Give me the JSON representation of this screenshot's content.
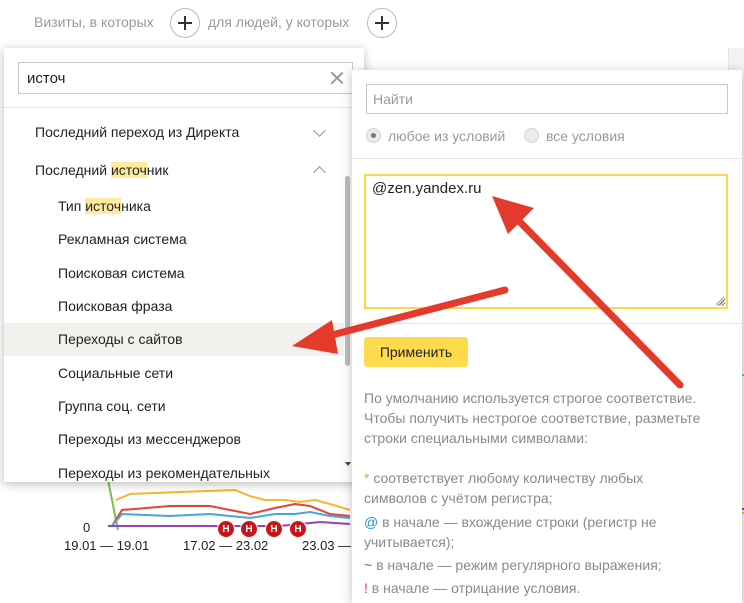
{
  "topbar": {
    "visits_label": "Визиты, в которых",
    "people_label": "для людей, у которых"
  },
  "dropdown": {
    "search_value": "источ",
    "items": [
      {
        "label": "Последний переход из Директа"
      },
      {
        "label_pre": "Последний ",
        "label_hl": "источ",
        "label_post": "ник"
      },
      {
        "label_pre": "Тип ",
        "label_hl": "источ",
        "label_post": "ника"
      },
      {
        "label": "Рекламная система"
      },
      {
        "label": "Поисковая система"
      },
      {
        "label": "Поисковая фраза"
      },
      {
        "label": "Переходы с сайтов"
      },
      {
        "label": "Социальные сети"
      },
      {
        "label": "Группа соц. сети"
      },
      {
        "label": "Переходы из мессенджеров"
      },
      {
        "label": "Переходы из рекомендательных"
      }
    ]
  },
  "filter": {
    "find_placeholder": "Найти",
    "radio_any": "любое из условий",
    "radio_all": "все условия",
    "value": "@zen.yandex.ru",
    "apply_label": "Применить",
    "hint_lines": [
      "По умолчанию используется строгое соответствие.",
      "Чтобы получить нестрогое соответствие, разметьте",
      "строки специальными символами:"
    ],
    "rules": {
      "star_symbol": "*",
      "star_text_1": " соответствует любому количеству любых",
      "star_text_2": "символов с учётом регистра;",
      "at_symbol": "@",
      "at_text_1": " в начале — вхождение строки (регистр не",
      "at_text_2": "учитывается);",
      "tilde_symbol": "~",
      "tilde_text": " в начале — режим регулярного выражения;",
      "bang_symbol": "!",
      "bang_text": " в начале — отрицание условия."
    }
  },
  "chart": {
    "zero_label": "0",
    "date_ranges": [
      "19.01 — 19.01",
      "17.02 — 23.02",
      "23.03 —"
    ],
    "badge_letter": "Н",
    "badge_count": 4,
    "colors": {
      "orange": "#f5b82e",
      "red": "#e8432f",
      "blue": "#4aa3df",
      "purple": "#9b3fb5",
      "green": "#7ac143"
    }
  }
}
